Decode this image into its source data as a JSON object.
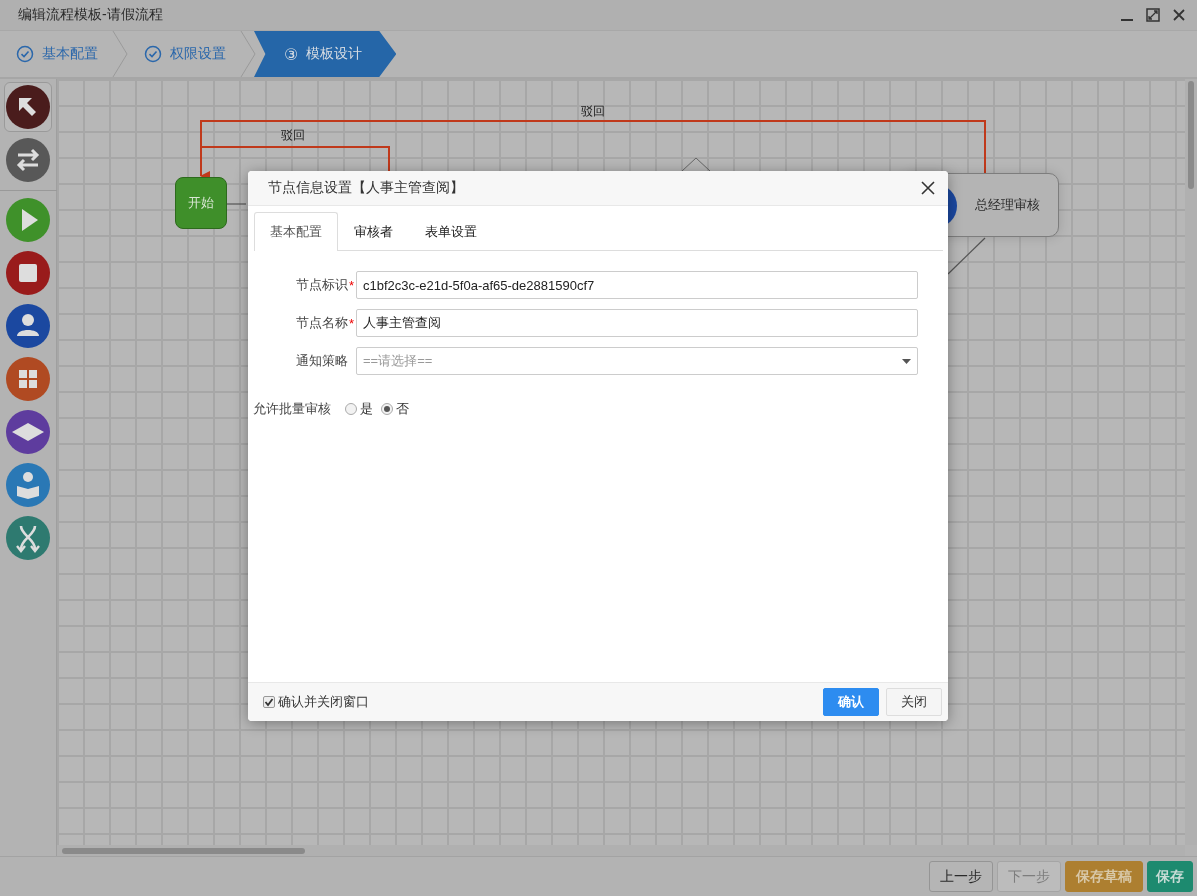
{
  "window": {
    "title": "编辑流程模板-请假流程"
  },
  "steps": [
    {
      "label": "基本配置",
      "done": true,
      "selected": false
    },
    {
      "label": "权限设置",
      "done": true,
      "selected": false
    },
    {
      "label": "模板设计",
      "done": false,
      "selected": true,
      "marker": "③"
    }
  ],
  "toolbar": {
    "tools": [
      {
        "kind": "pointer",
        "selected": true
      },
      {
        "kind": "connect",
        "selected": false
      },
      {
        "kind": "start",
        "selected": false
      },
      {
        "kind": "end",
        "selected": false
      },
      {
        "kind": "user",
        "selected": false
      },
      {
        "kind": "grid",
        "selected": false
      },
      {
        "kind": "gateway",
        "selected": false
      },
      {
        "kind": "reader",
        "selected": false
      },
      {
        "kind": "fork",
        "selected": false
      }
    ]
  },
  "canvas": {
    "nodes": [
      {
        "kind": "start",
        "label": "开始"
      },
      {
        "kind": "gateway"
      },
      {
        "kind": "task",
        "label": "总经理审核"
      }
    ],
    "links": [
      {
        "kind": "reject",
        "label": "驳回"
      },
      {
        "kind": "reject",
        "label": "驳回"
      },
      {
        "kind": "normal"
      },
      {
        "kind": "normal"
      }
    ]
  },
  "dialog": {
    "title": "节点信息设置【人事主管查阅】",
    "tabs": [
      {
        "label": "基本配置",
        "selected": true
      },
      {
        "label": "审核者",
        "selected": false
      },
      {
        "label": "表单设置",
        "selected": false
      }
    ],
    "fields": [
      {
        "kind": "text",
        "label": "节点标识",
        "required_mark": "*",
        "value": "c1bf2c3c-e21d-5f0a-af65-de2881590cf7"
      },
      {
        "kind": "text",
        "label": "节点名称",
        "required_mark": "*",
        "value": "人事主管查阅"
      },
      {
        "kind": "select",
        "label": "通知策略",
        "placeholder": "==请选择=="
      },
      {
        "kind": "radio",
        "label": "允许批量审核",
        "options": [
          {
            "label": "是",
            "selected": false
          },
          {
            "label": "否",
            "selected": true
          }
        ]
      }
    ],
    "footer": {
      "checkbox": {
        "label": "确认并关闭窗口",
        "checked": true
      },
      "buttons": [
        {
          "kind": "primary",
          "label": "确认"
        },
        {
          "kind": "default",
          "label": "关闭"
        }
      ]
    }
  },
  "footer_buttons": [
    {
      "kind": "default",
      "label": "上一步",
      "disabled": false
    },
    {
      "kind": "default",
      "label": "下一步",
      "disabled": true
    },
    {
      "kind": "warning",
      "label": "保存草稿",
      "disabled": false
    },
    {
      "kind": "success",
      "label": "保存",
      "disabled": false
    }
  ]
}
